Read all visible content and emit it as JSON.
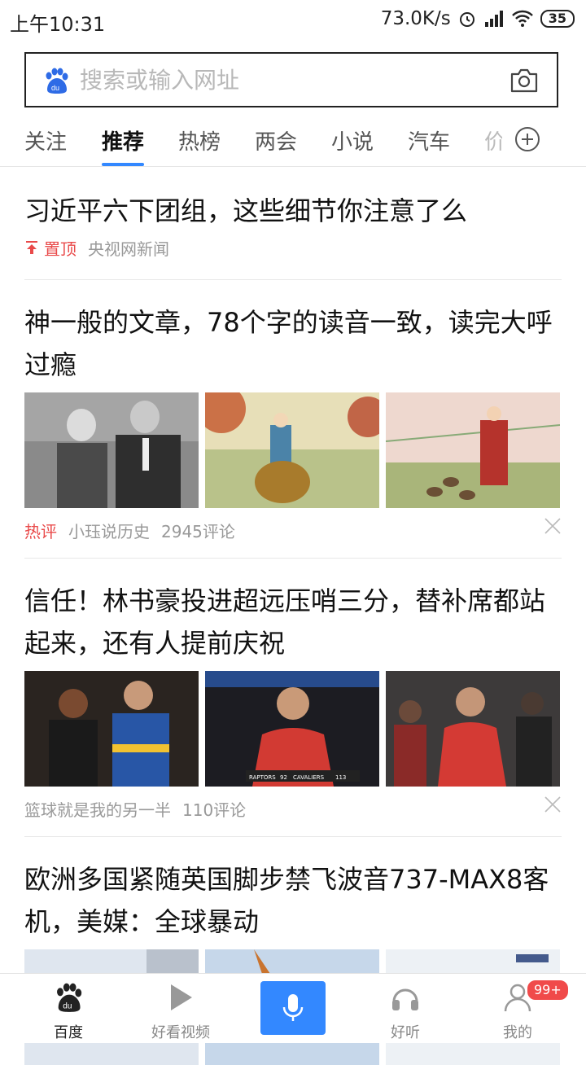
{
  "statusbar": {
    "time": "上午10:31",
    "speed": "73.0K/s",
    "battery": "35"
  },
  "search": {
    "placeholder": "搜索或输入网址"
  },
  "tabs": [
    "关注",
    "推荐",
    "热榜",
    "两会",
    "小说",
    "汽车",
    "价"
  ],
  "active_tab": "推荐",
  "articles": [
    {
      "title": "习近平六下团组，这些细节你注意了么",
      "pin_label": "置顶",
      "source": "央视网新闻"
    },
    {
      "title": "神一般的文章，78个字的读音一致，读完大呼过瘾",
      "tag": "热评",
      "source": "小珏说历史",
      "comments": "2945评论"
    },
    {
      "title": "信任！林书豪投进超远压哨三分，替补席都站起来，还有人提前庆祝",
      "source": "篮球就是我的另一半",
      "comments": "110评论",
      "scoreboard": {
        "team1": "RAPTORS",
        "score1": "92",
        "team2": "CAVALIERS",
        "score2": "113"
      }
    },
    {
      "title": "欧洲多国紧随英国脚步禁飞波音737-MAX8客机，美媒：全球暴动"
    }
  ],
  "bottomnav": {
    "home": "百度",
    "video": "好看视频",
    "listen": "好听",
    "mine": "我的",
    "badge": "99+"
  },
  "colors": {
    "accent": "#3388ff",
    "hot": "#e94a4a"
  }
}
